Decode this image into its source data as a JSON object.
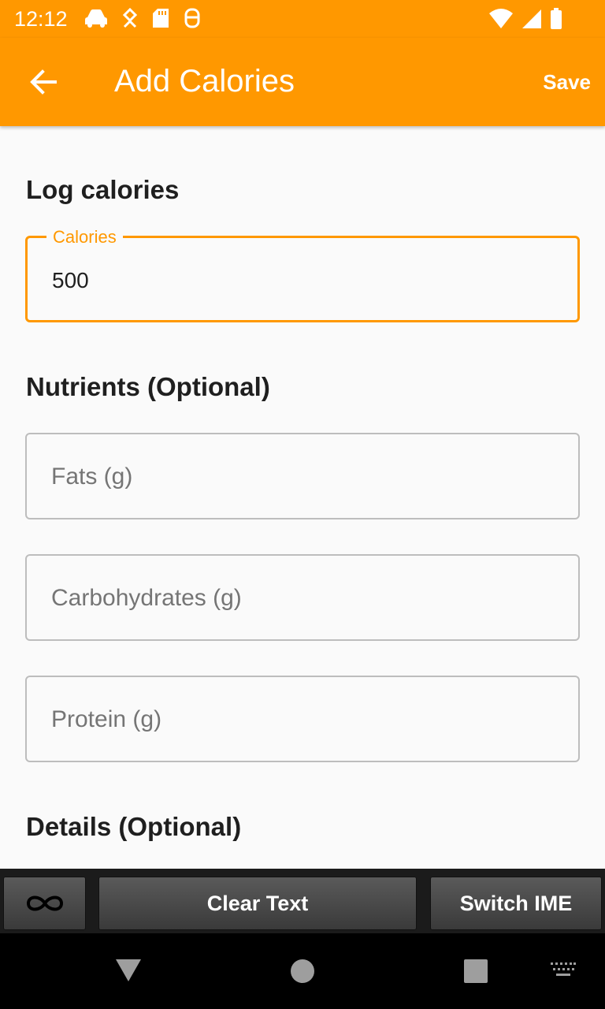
{
  "status_bar": {
    "time": "12:12",
    "left_icons": [
      "car-icon",
      "location-icon",
      "sd-card-icon",
      "notification-icon"
    ],
    "right_icons": [
      "wifi-icon",
      "signal-icon",
      "battery-icon"
    ]
  },
  "app_bar": {
    "title": "Add Calories",
    "save_label": "Save",
    "back_icon": "arrow-back-icon"
  },
  "form": {
    "log_heading": "Log calories",
    "calories": {
      "label": "Calories",
      "value": "500"
    },
    "nutrients_heading": "Nutrients (Optional)",
    "fats": {
      "placeholder": "Fats (g)"
    },
    "carbs": {
      "placeholder": "Carbohydrates (g)"
    },
    "protein": {
      "placeholder": "Protein (g)"
    },
    "details_heading": "Details (Optional)"
  },
  "toolbar": {
    "infinity_icon": "infinity-icon",
    "clear_label": "Clear Text",
    "switch_label": "Switch IME"
  },
  "nav_bar": {
    "icons": [
      "back-triangle-icon",
      "home-circle-icon",
      "recents-square-icon",
      "keyboard-icon"
    ]
  },
  "colors": {
    "accent": "#ff9800",
    "background": "#fafafa",
    "text": "#1f1f1f",
    "placeholder": "#757575"
  }
}
